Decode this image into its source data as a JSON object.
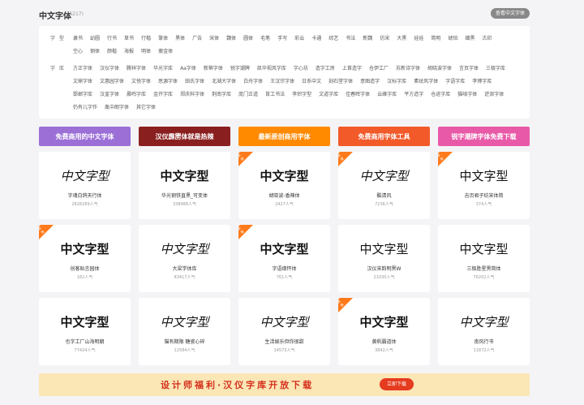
{
  "header": {
    "title": "中文字体",
    "count": "(5217)",
    "show_button": "查看中文字体"
  },
  "filters": {
    "style": {
      "label": "字型",
      "tags": [
        "隶书",
        "幼圆",
        "行书",
        "草书",
        "行楷",
        "篆体",
        "黑体",
        "广告",
        "宋体",
        "魏体",
        "圆体",
        "毛笔",
        "手写",
        "彩云",
        "卡通",
        "综艺",
        "书法",
        "新魏",
        "仿宋",
        "大黑",
        "娃娃",
        "简明",
        "琥珀",
        "细黑",
        "古印",
        "空心",
        "钢体",
        "颜楷",
        "海报",
        "明体",
        "瘦金体"
      ]
    },
    "foundry": {
      "label": "字库",
      "tags": [
        "方正字体",
        "汉仪字体",
        "腾祥字体",
        "华光字库",
        "Aa字体",
        "新蒂字体",
        "锐字潮牌",
        "凯华视风字库",
        "字心坊",
        "造字工房",
        "上首造字",
        "仓伊工厂",
        "苏新诗字体",
        "胡晓波字体",
        "言页字体",
        "三极字库",
        "文鼎字体",
        "文惠园字体",
        "文悦字体",
        "思源字体",
        "田氏字体",
        "北湖大字体",
        "白舟字体",
        "王汉宗字体",
        "日系中文",
        "刻石堂字体",
        "意图造字",
        "汉标字库",
        "素纹风字体",
        "字语字库",
        "李博字库",
        "邯郸字库",
        "汉皇字体",
        "晨鸣字库",
        "金开字库",
        "郑庆科字体",
        "荆南字库",
        "庞门正道",
        "筲工书法",
        "李炽字型",
        "文道字库",
        "佳春晖字体",
        "云峰字库",
        "平方造字",
        "仓迹字库",
        "猫啃字体",
        "逆浪字体",
        "仍有儿字作",
        "胤中朗字体",
        "其它字体"
      ]
    }
  },
  "banners": [
    {
      "label": "免费商用的中文字体",
      "color": "#9b6fd6"
    },
    {
      "label": "汉仪霹雳体就是热辣",
      "color": "#8a1f1f"
    },
    {
      "label": "最新原创商用字体",
      "color": "#ff8a00"
    },
    {
      "label": "免费商用字体工具",
      "color": "#f25a2a"
    },
    {
      "label": "锐字潮牌字体免费下载",
      "color": "#e85aa8"
    }
  ],
  "corner_label": "推荐",
  "sample_text": "中文字型",
  "fonts": [
    {
      "name": "字魂白鸽天行体",
      "pop": "2828289人气",
      "hot": false,
      "style": "serif"
    },
    {
      "name": "华光钢铁直黑_可变体",
      "pop": "338488人气",
      "hot": false,
      "style": "bold"
    },
    {
      "name": "胡晓波-香辣体",
      "pop": "2427人气",
      "hot": true,
      "style": "bold"
    },
    {
      "name": "酷清风",
      "pop": "7236人气",
      "hot": true,
      "style": "serif"
    },
    {
      "name": "吉页君子纺宋体简",
      "pop": "374人气",
      "hot": true,
      "style": "thin"
    },
    {
      "name": "创客贴言园体",
      "pop": "182人气",
      "hot": true,
      "style": "bold"
    },
    {
      "name": "大梁学体库",
      "pop": "83417人气",
      "hot": false,
      "style": "serif"
    },
    {
      "name": "字语缘怀体",
      "pop": "761人气",
      "hot": true,
      "style": "bold"
    },
    {
      "name": "汉仪宋韵明黑W",
      "pop": "21030人气",
      "hot": false,
      "style": "thin"
    },
    {
      "name": "三极胜星黑简体",
      "pop": "76202人气",
      "hot": false,
      "style": "thin"
    },
    {
      "name": "也字工厂山海明朝",
      "pop": "77424人气",
      "hot": false,
      "style": "bold"
    },
    {
      "name": "猫有期限 糖瓷心碎",
      "pop": "12584人气",
      "hot": false,
      "style": "serif"
    },
    {
      "name": "生活娱乐但你很甜",
      "pop": "14573人气",
      "hot": false,
      "style": "serif"
    },
    {
      "name": "黄帆霸道体",
      "pop": "3842人气",
      "hot": true,
      "style": "bold"
    },
    {
      "name": "南风行书",
      "pop": "11872人气",
      "hot": false,
      "style": "serif"
    }
  ],
  "bottom_banner": {
    "text": "设计师福利·汉仪字库开放下载",
    "button": "立即下载"
  }
}
